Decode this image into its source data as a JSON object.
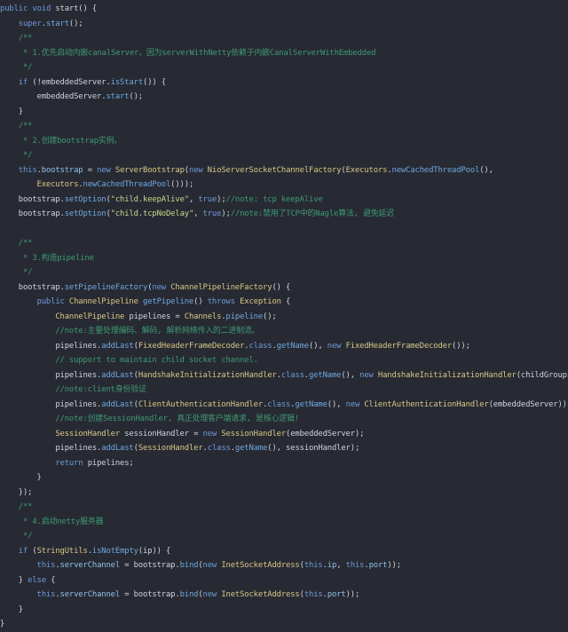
{
  "editor": {
    "colors": {
      "background": "#272a33",
      "keyword": "#6d9ad8",
      "function": "#6fa8e0",
      "class": "#d9c785",
      "string": "#c8d88a",
      "comment": "#3f9a73",
      "plain": "#cfd3dc"
    },
    "lines": [
      [
        [
          "kw",
          "public "
        ],
        [
          "kw",
          "void "
        ],
        [
          "pl",
          "start() {"
        ]
      ],
      [
        [
          "pl",
          "    "
        ],
        [
          "kw",
          "super"
        ],
        [
          "pl",
          "."
        ],
        [
          "fn",
          "start"
        ],
        [
          "pl",
          "();"
        ]
      ],
      [
        [
          "cmt",
          "    /**"
        ]
      ],
      [
        [
          "cmt",
          "     * 1.优先启动内嵌canalServer，因为serverWithNetty依赖于内嵌CanalServerWithEmbedded"
        ]
      ],
      [
        [
          "cmt",
          "     */"
        ]
      ],
      [
        [
          "pl",
          "    "
        ],
        [
          "kw",
          "if "
        ],
        [
          "pl",
          "(!embeddedServer."
        ],
        [
          "fn",
          "isStart"
        ],
        [
          "pl",
          "()) {"
        ]
      ],
      [
        [
          "pl",
          "        embeddedServer."
        ],
        [
          "fn",
          "start"
        ],
        [
          "pl",
          "();"
        ]
      ],
      [
        [
          "pl",
          "    }"
        ]
      ],
      [
        [
          "cmt",
          "    /**"
        ]
      ],
      [
        [
          "cmt",
          "     * 2.创建bootstrap实例。"
        ]
      ],
      [
        [
          "cmt",
          "     */"
        ]
      ],
      [
        [
          "pl",
          "    "
        ],
        [
          "kw",
          "this"
        ],
        [
          "pl",
          "."
        ],
        [
          "fld",
          "bootstrap"
        ],
        [
          "pl",
          " = "
        ],
        [
          "kw",
          "new "
        ],
        [
          "cls",
          "ServerBootstrap"
        ],
        [
          "pl",
          "("
        ],
        [
          "kw",
          "new "
        ],
        [
          "cls",
          "NioServerSocketChannelFactory"
        ],
        [
          "pl",
          "("
        ],
        [
          "cls",
          "Executors"
        ],
        [
          "pl",
          "."
        ],
        [
          "fn",
          "newCachedThreadPool"
        ],
        [
          "pl",
          "(),"
        ]
      ],
      [
        [
          "pl",
          "        "
        ],
        [
          "cls",
          "Executors"
        ],
        [
          "pl",
          "."
        ],
        [
          "fn",
          "newCachedThreadPool"
        ],
        [
          "pl",
          "()));"
        ]
      ],
      [
        [
          "pl",
          "    bootstrap."
        ],
        [
          "fn",
          "setOption"
        ],
        [
          "pl",
          "("
        ],
        [
          "str",
          "\"child.keepAlive\""
        ],
        [
          "pl",
          ", "
        ],
        [
          "kw",
          "true"
        ],
        [
          "pl",
          ");"
        ],
        [
          "cmt",
          "//note: tcp keepAlive"
        ]
      ],
      [
        [
          "pl",
          "    bootstrap."
        ],
        [
          "fn",
          "setOption"
        ],
        [
          "pl",
          "("
        ],
        [
          "str",
          "\"child.tcpNoDelay\""
        ],
        [
          "pl",
          ", "
        ],
        [
          "kw",
          "true"
        ],
        [
          "pl",
          ");"
        ],
        [
          "cmt",
          "//note:禁用了TCP中的Nagle算法, 避免延迟"
        ]
      ],
      [
        [
          "pl",
          ""
        ]
      ],
      [
        [
          "cmt",
          "    /**"
        ]
      ],
      [
        [
          "cmt",
          "     * 3.构造pipeline"
        ]
      ],
      [
        [
          "cmt",
          "     */"
        ]
      ],
      [
        [
          "pl",
          "    bootstrap."
        ],
        [
          "fn",
          "setPipelineFactory"
        ],
        [
          "pl",
          "("
        ],
        [
          "kw",
          "new "
        ],
        [
          "cls",
          "ChannelPipelineFactory"
        ],
        [
          "pl",
          "() {"
        ]
      ],
      [
        [
          "pl",
          "        "
        ],
        [
          "kw",
          "public "
        ],
        [
          "cls",
          "ChannelPipeline "
        ],
        [
          "fn",
          "getPipeline"
        ],
        [
          "pl",
          "() "
        ],
        [
          "kw",
          "throws "
        ],
        [
          "cls",
          "Exception"
        ],
        [
          "pl",
          " {"
        ]
      ],
      [
        [
          "pl",
          "            "
        ],
        [
          "cls",
          "ChannelPipeline "
        ],
        [
          "pl",
          "pipelines = "
        ],
        [
          "cls",
          "Channels"
        ],
        [
          "pl",
          "."
        ],
        [
          "fn",
          "pipeline"
        ],
        [
          "pl",
          "();"
        ]
      ],
      [
        [
          "cmt",
          "            //note:主要处理编码、解码, 解析网络传入的二进制流。"
        ]
      ],
      [
        [
          "pl",
          "            pipelines."
        ],
        [
          "fn",
          "addLast"
        ],
        [
          "pl",
          "("
        ],
        [
          "cls",
          "FixedHeaderFrameDecoder"
        ],
        [
          "pl",
          "."
        ],
        [
          "kw",
          "class"
        ],
        [
          "pl",
          "."
        ],
        [
          "fn",
          "getName"
        ],
        [
          "pl",
          "(), "
        ],
        [
          "kw",
          "new "
        ],
        [
          "cls",
          "FixedHeaderFrameDecoder"
        ],
        [
          "pl",
          "());"
        ]
      ],
      [
        [
          "cmt",
          "            // support to maintain child socket channel."
        ]
      ],
      [
        [
          "pl",
          "            pipelines."
        ],
        [
          "fn",
          "addLast"
        ],
        [
          "pl",
          "("
        ],
        [
          "cls",
          "HandshakeInitializationHandler"
        ],
        [
          "pl",
          "."
        ],
        [
          "kw",
          "class"
        ],
        [
          "pl",
          "."
        ],
        [
          "fn",
          "getName"
        ],
        [
          "pl",
          "(), "
        ],
        [
          "kw",
          "new "
        ],
        [
          "cls",
          "HandshakeInitializationHandler"
        ],
        [
          "pl",
          "(childGroups));"
        ]
      ],
      [
        [
          "cmt",
          "            //note:client身份验证"
        ]
      ],
      [
        [
          "pl",
          "            pipelines."
        ],
        [
          "fn",
          "addLast"
        ],
        [
          "pl",
          "("
        ],
        [
          "cls",
          "ClientAuthenticationHandler"
        ],
        [
          "pl",
          "."
        ],
        [
          "kw",
          "class"
        ],
        [
          "pl",
          "."
        ],
        [
          "fn",
          "getName"
        ],
        [
          "pl",
          "(), "
        ],
        [
          "kw",
          "new "
        ],
        [
          "cls",
          "ClientAuthenticationHandler"
        ],
        [
          "pl",
          "(embeddedServer));"
        ]
      ],
      [
        [
          "cmt",
          "            //note:创建SessionHandler, 真正处理客户端请求, 是核心逻辑!"
        ]
      ],
      [
        [
          "pl",
          "            "
        ],
        [
          "cls",
          "SessionHandler "
        ],
        [
          "pl",
          "sessionHandler = "
        ],
        [
          "kw",
          "new "
        ],
        [
          "cls",
          "SessionHandler"
        ],
        [
          "pl",
          "(embeddedServer);"
        ]
      ],
      [
        [
          "pl",
          "            pipelines."
        ],
        [
          "fn",
          "addLast"
        ],
        [
          "pl",
          "("
        ],
        [
          "cls",
          "SessionHandler"
        ],
        [
          "pl",
          "."
        ],
        [
          "kw",
          "class"
        ],
        [
          "pl",
          "."
        ],
        [
          "fn",
          "getName"
        ],
        [
          "pl",
          "(), sessionHandler);"
        ]
      ],
      [
        [
          "pl",
          "            "
        ],
        [
          "kw",
          "return "
        ],
        [
          "pl",
          "pipelines;"
        ]
      ],
      [
        [
          "pl",
          "        }"
        ]
      ],
      [
        [
          "pl",
          "    });"
        ]
      ],
      [
        [
          "cmt",
          "    /**"
        ]
      ],
      [
        [
          "cmt",
          "     * 4.启动netty服务器"
        ]
      ],
      [
        [
          "cmt",
          "     */"
        ]
      ],
      [
        [
          "pl",
          "    "
        ],
        [
          "kw",
          "if "
        ],
        [
          "pl",
          "("
        ],
        [
          "cls",
          "StringUtils"
        ],
        [
          "pl",
          "."
        ],
        [
          "fn",
          "isNotEmpty"
        ],
        [
          "pl",
          "(ip)) {"
        ]
      ],
      [
        [
          "pl",
          "        "
        ],
        [
          "kw",
          "this"
        ],
        [
          "pl",
          "."
        ],
        [
          "fld",
          "serverChannel"
        ],
        [
          "pl",
          " = bootstrap."
        ],
        [
          "fn",
          "bind"
        ],
        [
          "pl",
          "("
        ],
        [
          "kw",
          "new "
        ],
        [
          "cls",
          "InetSocketAddress"
        ],
        [
          "pl",
          "("
        ],
        [
          "kw",
          "this"
        ],
        [
          "pl",
          "."
        ],
        [
          "fld",
          "ip"
        ],
        [
          "pl",
          ", "
        ],
        [
          "kw",
          "this"
        ],
        [
          "pl",
          "."
        ],
        [
          "fld",
          "port"
        ],
        [
          "pl",
          "));"
        ]
      ],
      [
        [
          "pl",
          "    } "
        ],
        [
          "kw",
          "else "
        ],
        [
          "pl",
          "{"
        ]
      ],
      [
        [
          "pl",
          "        "
        ],
        [
          "kw",
          "this"
        ],
        [
          "pl",
          "."
        ],
        [
          "fld",
          "serverChannel"
        ],
        [
          "pl",
          " = bootstrap."
        ],
        [
          "fn",
          "bind"
        ],
        [
          "pl",
          "("
        ],
        [
          "kw",
          "new "
        ],
        [
          "cls",
          "InetSocketAddress"
        ],
        [
          "pl",
          "("
        ],
        [
          "kw",
          "this"
        ],
        [
          "pl",
          "."
        ],
        [
          "fld",
          "port"
        ],
        [
          "pl",
          "));"
        ]
      ],
      [
        [
          "pl",
          "    }"
        ]
      ],
      [
        [
          "pl",
          "}"
        ]
      ]
    ]
  }
}
